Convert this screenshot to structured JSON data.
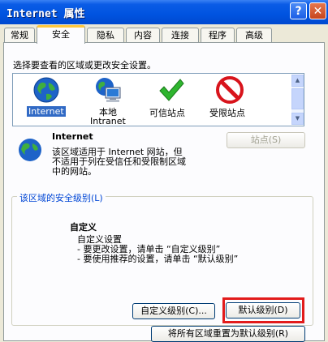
{
  "window": {
    "title": "Internet 属性",
    "help_glyph": "?",
    "close_glyph": "✕"
  },
  "tabs": [
    {
      "label": "常规"
    },
    {
      "label": "安全"
    },
    {
      "label": "隐私"
    },
    {
      "label": "内容"
    },
    {
      "label": "连接"
    },
    {
      "label": "程序"
    },
    {
      "label": "高级"
    }
  ],
  "active_tab": "安全",
  "security": {
    "instruction": "选择要查看的区域或更改安全设置。",
    "zones": [
      {
        "label": "Internet",
        "selected": true,
        "icon": "globe-icon"
      },
      {
        "label": "本地 Intranet",
        "line1": "本地",
        "line2": "Intranet",
        "icon": "local-intranet-icon"
      },
      {
        "label": "可信站点",
        "icon": "checkmark-icon"
      },
      {
        "label": "受限站点",
        "icon": "no-entry-icon"
      }
    ],
    "zone_detail": {
      "title": "Internet",
      "desc_line1": "该区域适用于 Internet 网站，但",
      "desc_line2": "不适用于列在受信任和受限制区域",
      "desc_line3": "中的网站。"
    },
    "sites_button": "站点(S)",
    "level_group_label": "该区域的安全级别(L)",
    "level": {
      "title": "自定义",
      "line1": "自定义设置",
      "line2": "- 要更改设置，请单击 “自定义级别”",
      "line3": "- 要使用推荐的设置，请单击 “默认级别”"
    },
    "custom_level_button": "自定义级别(C)...",
    "default_level_button": "默认级别(D)",
    "reset_all_button": "将所有区域重置为默认级别(R)"
  },
  "colors": {
    "titlebar": "#0053e0",
    "selection": "#316ac5",
    "highlight_box": "#e21b1b",
    "dialog_bg": "#ece9d8"
  }
}
